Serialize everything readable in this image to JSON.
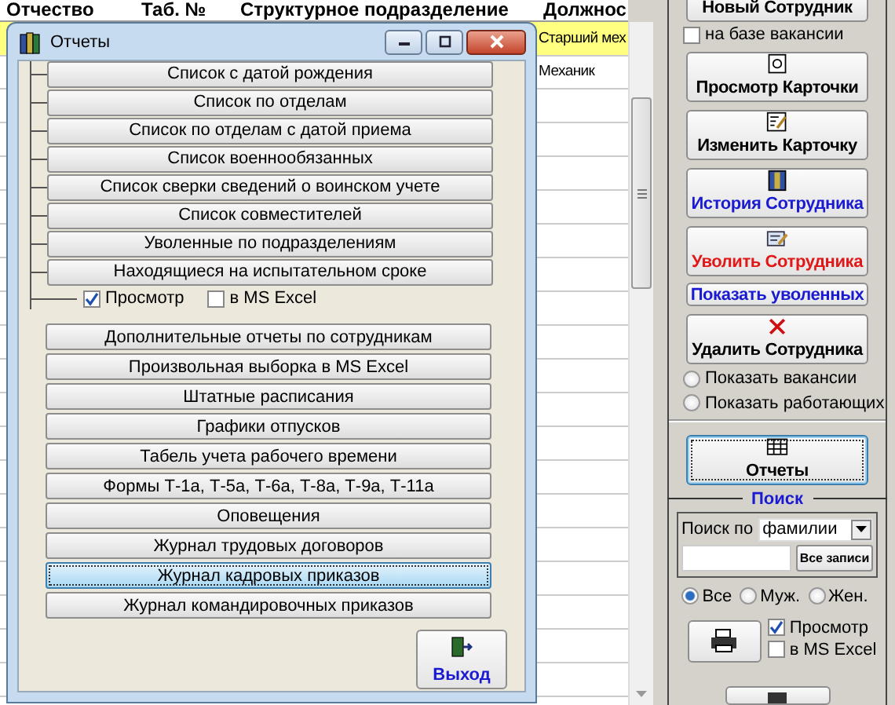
{
  "table": {
    "columns": [
      "Отчество",
      "Таб. №",
      "Структурное подразделение",
      "Должнос"
    ],
    "rows": [
      {
        "position": "Старший мех",
        "highlighted": true
      },
      {
        "position": "Механик",
        "highlighted": false
      }
    ]
  },
  "dialog": {
    "title": "Отчеты",
    "tree_reports": [
      "Список с датой рождения",
      "Список по отделам",
      "Список по отделам с датой приема",
      "Список военнообязанных",
      "Список сверки сведений о воинском учете",
      "Список совместителей",
      "Уволенные по подразделениям",
      "Находящиеся на испытательном сроке"
    ],
    "output_options": [
      {
        "label": "Просмотр",
        "checked": true
      },
      {
        "label": "в MS Excel",
        "checked": false
      }
    ],
    "reports": [
      {
        "label": "Дополнительные отчеты по сотрудникам",
        "selected": false
      },
      {
        "label": "Произвольная выборка в MS Excel",
        "selected": false
      },
      {
        "label": "Штатные расписания",
        "selected": false
      },
      {
        "label": "Графики отпусков",
        "selected": false
      },
      {
        "label": "Табель учета рабочего времени",
        "selected": false
      },
      {
        "label": "Формы Т-1а, Т-5а, Т-6а, Т-8а, Т-9а, Т-11а",
        "selected": false
      },
      {
        "label": "Оповещения",
        "selected": false
      },
      {
        "label": "Журнал трудовых договоров",
        "selected": false
      },
      {
        "label": "Журнал кадровых приказов",
        "selected": true
      },
      {
        "label": "Журнал командировочных приказов",
        "selected": false
      }
    ],
    "exit_button": "Выход"
  },
  "side_panel": {
    "items": [
      {
        "kind": "icon-button",
        "label": "Новый Сотрудник",
        "color": "#000000"
      },
      {
        "kind": "checkbox",
        "label": "на базе вакансии",
        "checked": false
      },
      {
        "kind": "icon-button",
        "label": "Просмотр Карточки",
        "color": "#000000"
      },
      {
        "kind": "icon-button",
        "label": "Изменить Карточку",
        "color": "#000000"
      },
      {
        "kind": "icon-button",
        "label": "История Сотрудника",
        "color": "#1a1ad0"
      },
      {
        "kind": "icon-button",
        "label": "Уволить Сотрудника",
        "color": "#e01818"
      },
      {
        "kind": "text-button",
        "label": "Показать уволенных",
        "color": "#1a1ad0"
      },
      {
        "kind": "icon-button",
        "label": "Удалить Сотрудника",
        "color": "#000000"
      },
      {
        "kind": "radio",
        "label": "Показать вакансии",
        "selected": false
      },
      {
        "kind": "radio",
        "label": "Показать работающих",
        "selected": false
      },
      {
        "kind": "separator"
      },
      {
        "kind": "icon-button",
        "label": "Отчеты",
        "color": "#000000",
        "focused": true
      }
    ],
    "search": {
      "title": "Поиск",
      "by_label": "Поиск по",
      "by_value": "фамилии",
      "all_button": "Все записи",
      "gender": [
        {
          "label": "Все",
          "selected": true
        },
        {
          "label": "Муж.",
          "selected": false
        },
        {
          "label": "Жен.",
          "selected": false
        }
      ]
    },
    "print_options": [
      {
        "label": "Просмотр",
        "checked": true
      },
      {
        "label": "в MS Excel",
        "checked": false
      }
    ]
  }
}
